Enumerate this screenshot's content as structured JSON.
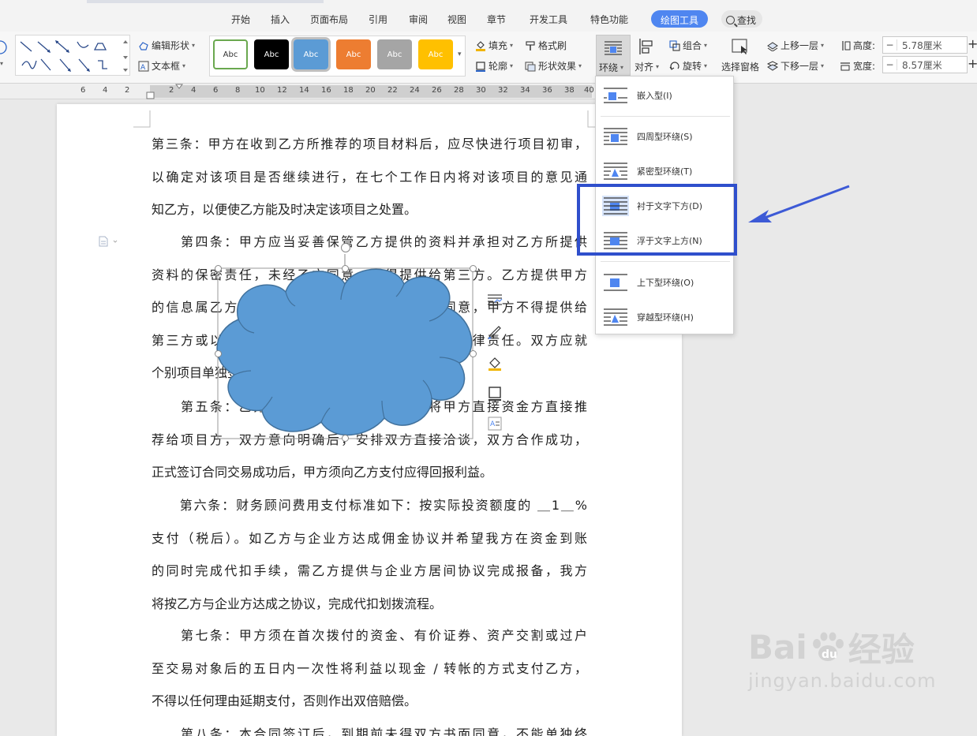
{
  "ribbon": {
    "tabs": [
      "开始",
      "插入",
      "页面布局",
      "引用",
      "审阅",
      "视图",
      "章节",
      "开发工具",
      "特色功能"
    ],
    "active_tab": "绘图工具",
    "search_label": "查找"
  },
  "toolbar": {
    "edit_shape": "编辑形状",
    "text_box": "文本框",
    "style_sample": "Abc",
    "fill": "填充",
    "format_painter": "格式刷",
    "outline": "轮廓",
    "shape_effects": "形状效果",
    "wrap": "环绕",
    "align": "对齐",
    "group": "组合",
    "rotate": "旋转",
    "selection_pane": "选择窗格",
    "bring_forward": "上移一层",
    "send_backward": "下移一层",
    "height_label": "高度:",
    "height_value": "5.78厘米",
    "width_label": "宽度:",
    "width_value": "8.57厘米",
    "style_colors": [
      "#ffffff",
      "#000000",
      "#5b9bd5",
      "#ed7d31",
      "#a5a5a5",
      "#ffc000"
    ]
  },
  "ruler": {
    "ticks": [
      "6",
      "4",
      "2",
      "2",
      "4",
      "6",
      "8",
      "10",
      "12",
      "14",
      "16",
      "18",
      "20",
      "22",
      "24",
      "26",
      "28",
      "30",
      "32",
      "34",
      "36",
      "38",
      "40"
    ]
  },
  "document": {
    "paragraphs": [
      [
        "第三条：甲方在收到乙方所推荐的项目材料后，应尽快进行项目初审，",
        "以确定对该项目是否继续进行，在七个工作日内将对该项目的意见通",
        "知乙方，以便使乙方能及时决定该项目之处置。"
      ],
      [
        "　　第四条：甲方应当妥善保管乙方提供的资料并承担对乙方所提供",
        "资料的保密责任，未经乙方同意，不得提供给第三方。乙方提供甲方",
        "的信息属乙方商业机密及无形资产，未经乙方同意，甲方不得提供给",
        "第三方或以其他方式交易，否则将承担相应经济法律责任。双方应就",
        "个别项目单独签订三方协议。"
      ],
      [
        "　　第五条：乙方在合作协议期限内有义务将甲方直接资金方直接推",
        "荐给项目方，双方意向明确后，安排双方直接洽谈，双方合作成功，",
        "正式签订合同交易成功后，甲方须向乙方支付应得回报利益。"
      ],
      [
        "　　第六条：财务顾问费用支付标准如下：按实际投资额度的 ＿1＿%",
        "支付（税后）。如乙方与企业方达成佣金协议并希望我方在资金到账",
        "的同时完成代扣手续，需乙方提供与企业方居间协议完成报备，我方",
        "将按乙方与企业方达成之协议，完成代扣划拨流程。"
      ],
      [
        "　　第七条：甲方须在首次拨付的资金、有价证券、资产交割或过户",
        "至交易对象后的五日内一次性将利益以现金 / 转帐的方式支付乙方，",
        "不得以任何理由延期支付，否则作出双倍赔偿。"
      ],
      [
        "　　第八条：本合同签订后，到期前未得双方书面同意，不能单独终"
      ]
    ]
  },
  "wrap_menu": {
    "items": [
      {
        "label": "嵌入型(I)"
      },
      {
        "label": "四周型环绕(S)"
      },
      {
        "label": "紧密型环绕(T)"
      },
      {
        "label": "衬于文字下方(D)"
      },
      {
        "label": "浮于文字上方(N)"
      },
      {
        "label": "上下型环绕(O)"
      },
      {
        "label": "穿越型环绕(H)"
      }
    ]
  },
  "colors": {
    "accent": "#4f86f0",
    "cloud_fill": "#5b9bd5",
    "highlight": "#2f4fcc"
  },
  "watermark": {
    "brand": "Bai",
    "brand_tail": "经验",
    "url": "jingyan.baidu.com"
  }
}
